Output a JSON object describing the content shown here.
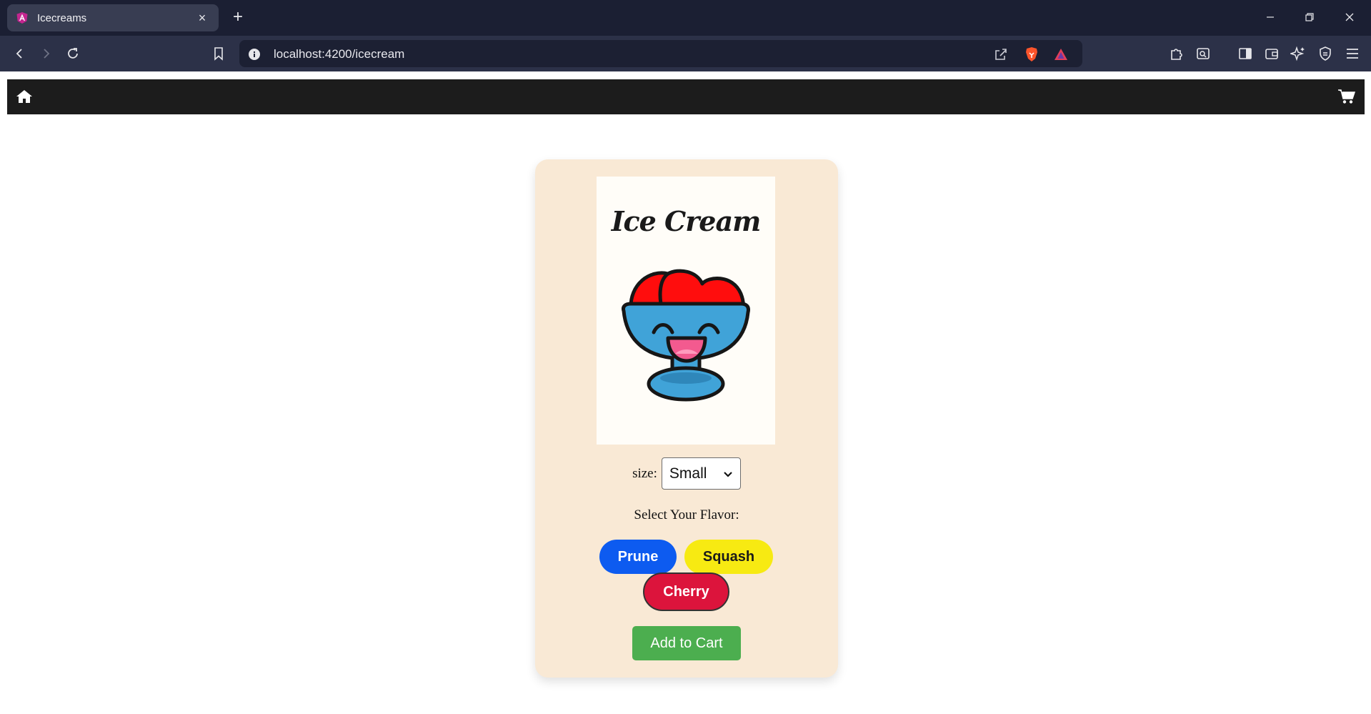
{
  "browser": {
    "tab_title": "Icecreams",
    "tab_close": "×",
    "new_tab": "+",
    "url": "localhost:4200/icecream"
  },
  "page": {
    "product_title": "Ice Cream",
    "size_label": "size:",
    "size_selected": "Small",
    "flavor_prompt": "Select Your Flavor:",
    "flavors": [
      {
        "label": "Prune",
        "color": "#0d5bf0"
      },
      {
        "label": "Squash",
        "color": "#f7ea12"
      },
      {
        "label": "Cherry",
        "color": "#dc143c"
      }
    ],
    "add_to_cart": "Add to Cart"
  },
  "colors": {
    "card_background": "#f9e9d5",
    "nav_background": "#1c1c1c",
    "add_to_cart": "#4cae4f"
  },
  "icons": [
    "home-icon",
    "cart-icon",
    "sundae-illustration"
  ]
}
